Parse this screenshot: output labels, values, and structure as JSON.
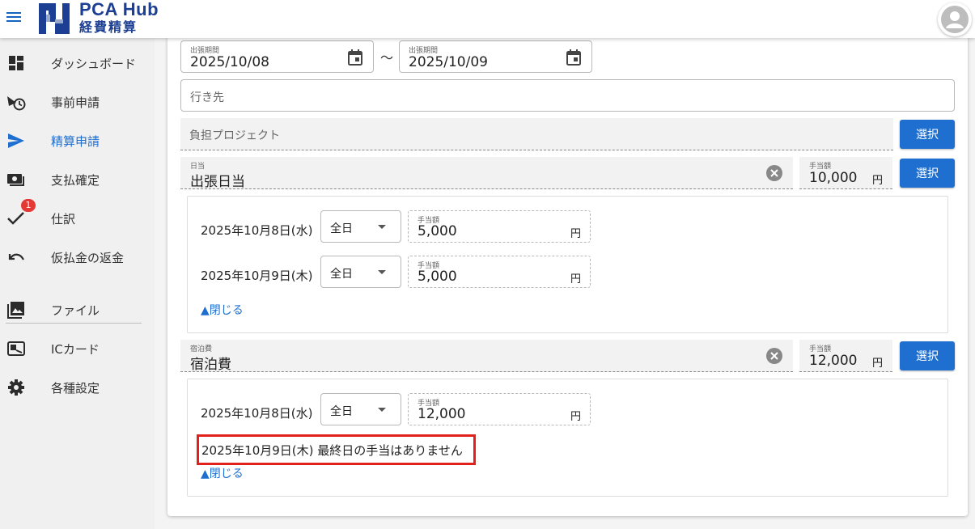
{
  "header": {
    "brand_top": "PCA Hub",
    "brand_bottom": "経費精算"
  },
  "colors": {
    "accent": "#1e6fd0",
    "brand": "#1c3f94",
    "badge": "#e53935",
    "highlight": "#e0211c"
  },
  "sidebar": {
    "items": [
      {
        "label": "ダッシュボード",
        "icon": "dashboard-icon"
      },
      {
        "label": "事前申請",
        "icon": "plane-clock-icon"
      },
      {
        "label": "精算申請",
        "icon": "send-icon",
        "active": true
      },
      {
        "label": "支払確定",
        "icon": "money-icon"
      },
      {
        "label": "仕訳",
        "icon": "check-icon",
        "badge": "1"
      },
      {
        "label": "仮払金の返金",
        "icon": "undo-icon"
      },
      {
        "label": "ファイル",
        "icon": "image-icon"
      },
      {
        "label": "ICカード",
        "icon": "card-icon"
      },
      {
        "label": "各種設定",
        "icon": "gear-icon"
      }
    ]
  },
  "form": {
    "period_label": "出張期間",
    "period_start": "2025/10/08",
    "period_end": "2025/10/09",
    "tilde": "〜",
    "destination_placeholder": "行き先",
    "project_placeholder": "負担プロジェクト",
    "select_label": "選択",
    "allowance_amount_label": "手当額",
    "yen": "円",
    "daily": {
      "label": "日当",
      "value": "出張日当",
      "total": "10,000",
      "days": [
        {
          "date": "2025年10月8日(水)",
          "type": "全日",
          "amount": "5,000"
        },
        {
          "date": "2025年10月9日(木)",
          "type": "全日",
          "amount": "5,000"
        }
      ],
      "close": "▲閉じる"
    },
    "lodging": {
      "label": "宿泊費",
      "value": "宿泊費",
      "total": "12,000",
      "days": [
        {
          "date": "2025年10月8日(水)",
          "type": "全日",
          "amount": "12,000"
        }
      ],
      "notice": "2025年10月9日(木)  最終日の手当はありません",
      "close": "▲閉じる"
    }
  }
}
